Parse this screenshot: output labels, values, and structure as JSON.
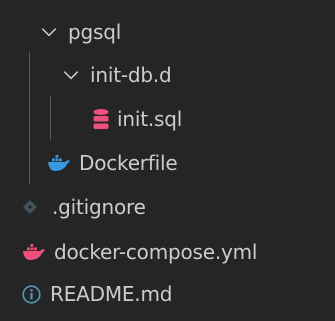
{
  "tree": {
    "items": [
      {
        "label": "pgsql",
        "icon": "chevron-down-icon",
        "expanded": true
      },
      {
        "label": "init-db.d",
        "icon": "chevron-down-icon",
        "expanded": true
      },
      {
        "label": "init.sql",
        "icon": "database-icon",
        "icon_color": "#f04e7b"
      },
      {
        "label": "Dockerfile",
        "icon": "docker-whale-icon",
        "icon_color": "#3a9ae0"
      },
      {
        "label": ".gitignore",
        "icon": "git-diamond-icon",
        "icon_color": "#41535b"
      },
      {
        "label": "docker-compose.yml",
        "icon": "docker-whale-icon",
        "icon_color": "#f04e7b"
      },
      {
        "label": "README.md",
        "icon": "info-icon",
        "icon_color": "#519aba"
      }
    ]
  },
  "colors": {
    "background": "#252526",
    "text": "#cccccc",
    "indent_guide": "#585858"
  }
}
